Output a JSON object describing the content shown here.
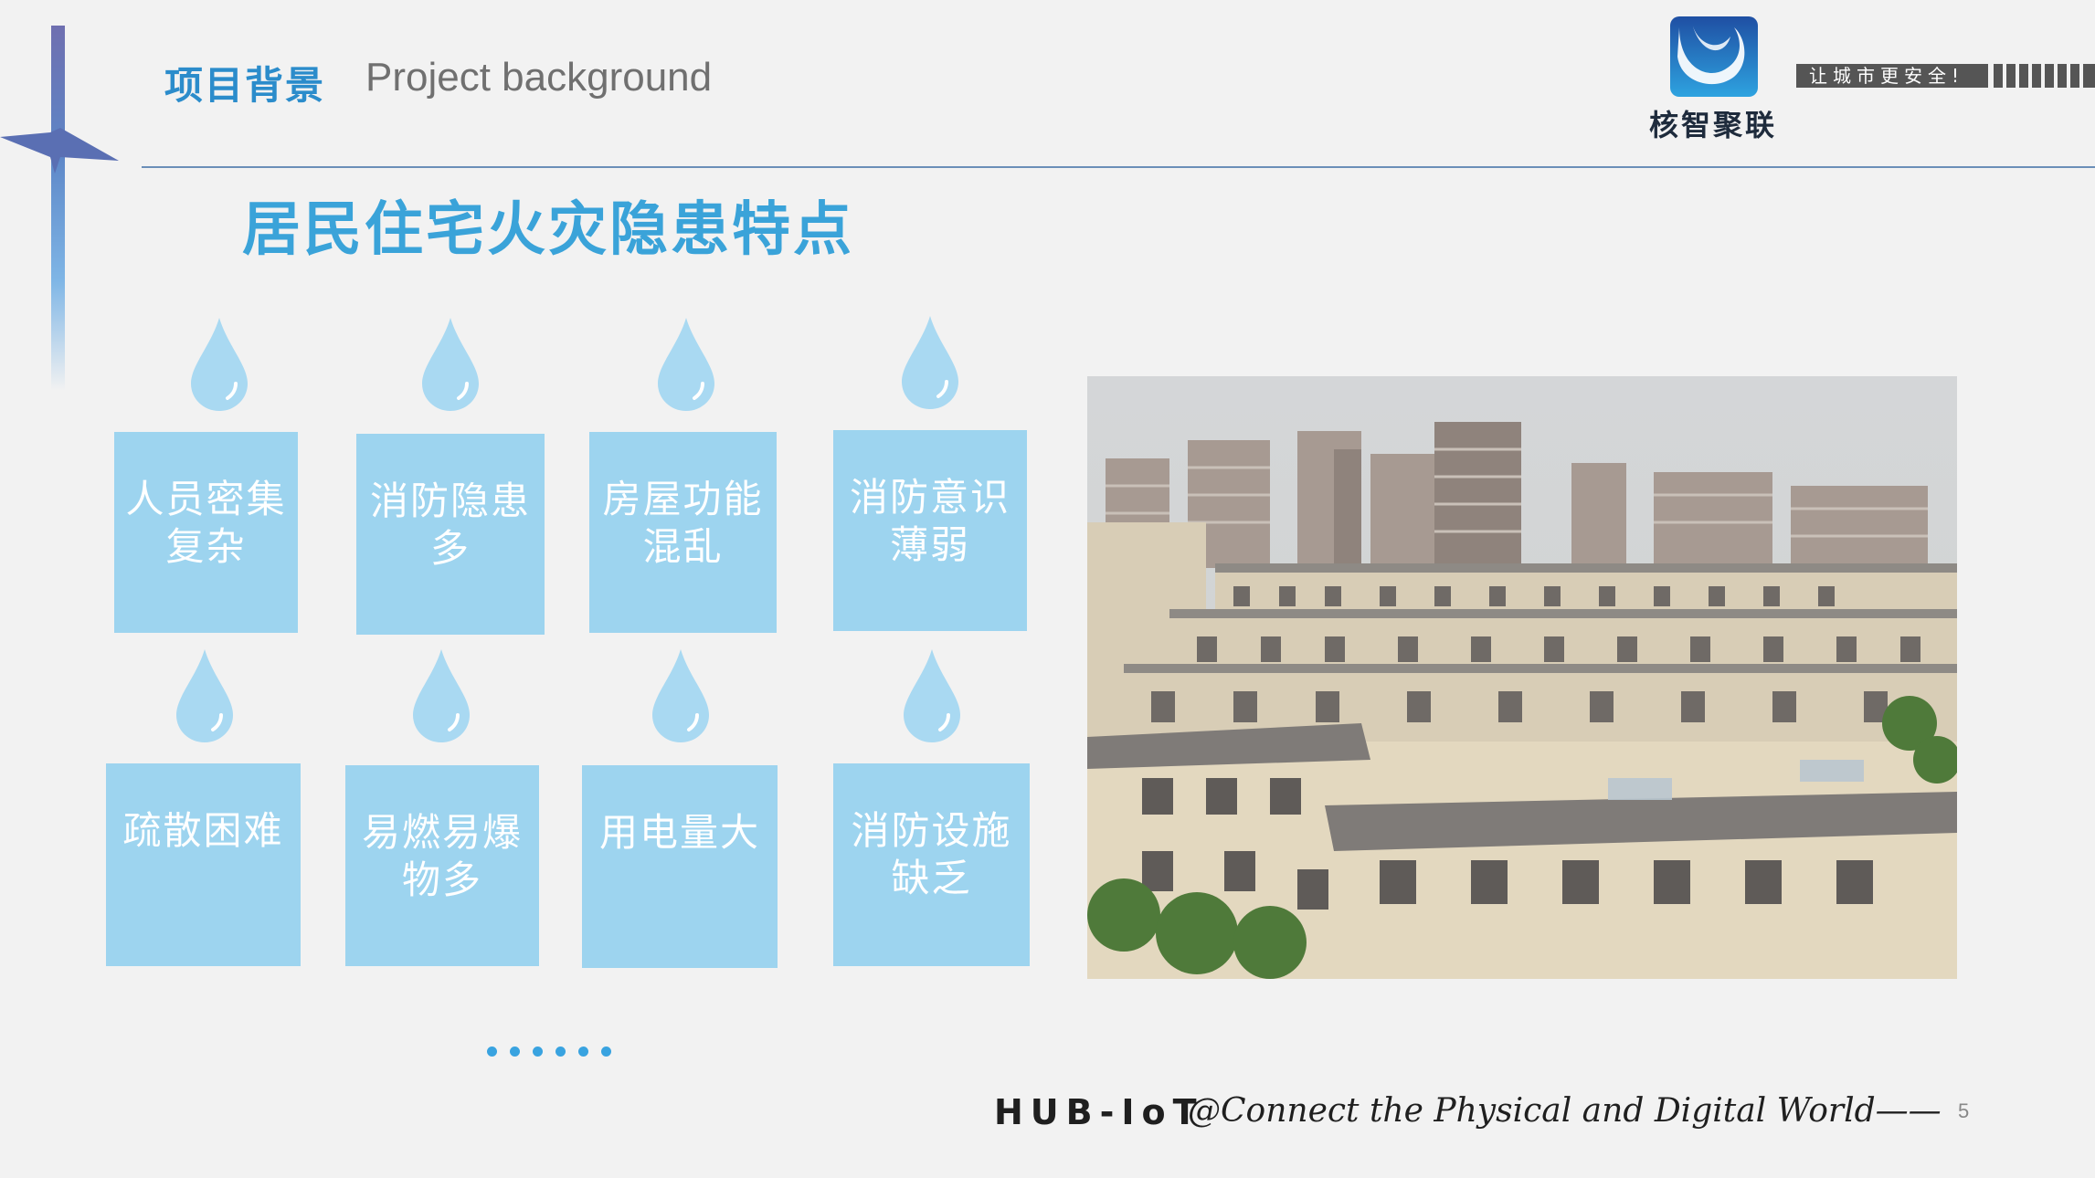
{
  "header": {
    "title_cn": "项目背景",
    "title_en": "Project background"
  },
  "logo": {
    "name": "核智聚联",
    "slogan": "让城市更安全!"
  },
  "section": {
    "title": "居民住宅火灾隐患特点"
  },
  "cards": [
    {
      "label": "人员密集复杂"
    },
    {
      "label": "消防隐患多"
    },
    {
      "label": "房屋功能混乱"
    },
    {
      "label": "消防意识薄弱"
    },
    {
      "label": "疏散困难"
    },
    {
      "label": "易燃易爆物多"
    },
    {
      "label": "用电量大"
    },
    {
      "label": "消防设施缺乏"
    }
  ],
  "colors": {
    "accent": "#3aa3d9",
    "card": "#9dd4ef",
    "drop": "#a9d9f2"
  },
  "photo": {
    "icon": "residential-buildings-photo"
  },
  "footer": {
    "brand": "HUB-IoT",
    "tagline": "@Connect the Physical and Digital World——",
    "page": "5"
  }
}
